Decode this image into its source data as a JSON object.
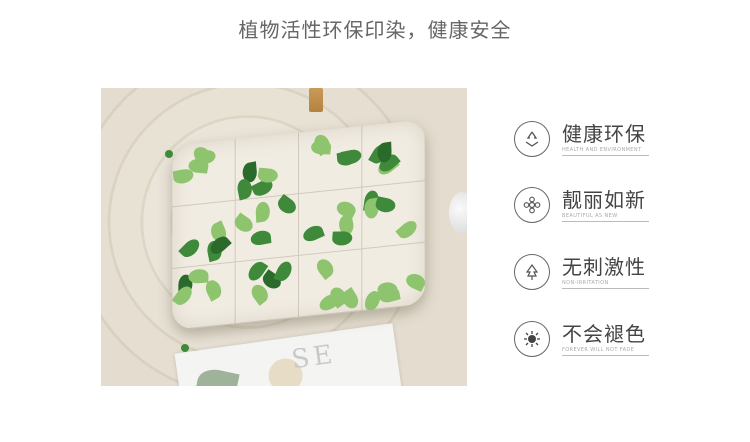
{
  "header": {
    "title": "植物活性环保印染，健康安全"
  },
  "photo": {
    "magazine_text": "SE"
  },
  "features": [
    {
      "icon": "recycle-icon",
      "title": "健康环保",
      "subtitle": "HEALTH AND ENVIRONMENT"
    },
    {
      "icon": "flower-icon",
      "title": "靓丽如新",
      "subtitle": "BEAUTIFUL AS NEW"
    },
    {
      "icon": "leaf-icon",
      "title": "无刺激性",
      "subtitle": "NON-IRRITATION"
    },
    {
      "icon": "splash-icon",
      "title": "不会褪色",
      "subtitle": "FOREVER WILL NOT FADE"
    }
  ]
}
